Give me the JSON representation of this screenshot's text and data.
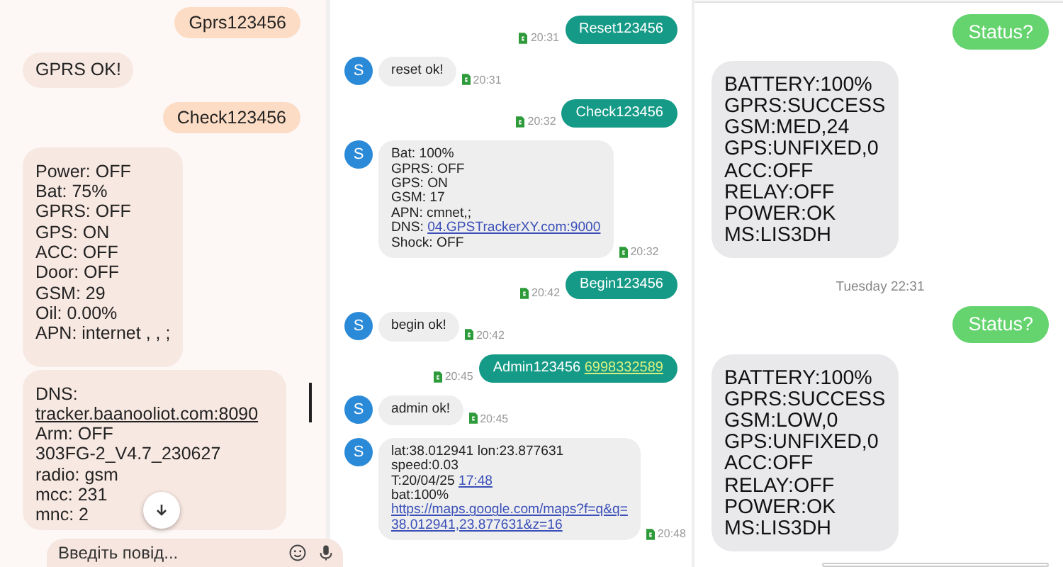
{
  "left_chat": {
    "messages": [
      {
        "kind": "out",
        "lines": [
          {
            "text": "Gprs123456"
          }
        ]
      },
      {
        "kind": "in",
        "lines": [
          {
            "text": "GPRS OK!"
          }
        ]
      },
      {
        "kind": "out",
        "lines": [
          {
            "text": "Check123456"
          }
        ]
      },
      {
        "kind": "in",
        "lines": [
          {
            "text": "Power: OFF"
          },
          {
            "text": "Bat: 75%"
          },
          {
            "text": "GPRS: OFF"
          },
          {
            "text": "GPS: ON"
          },
          {
            "text": "ACC: OFF"
          },
          {
            "text": "Door: OFF"
          },
          {
            "text": "GSM: 29"
          },
          {
            "text": "Oil: 0.00%"
          },
          {
            "text": "APN: internet , , ;"
          }
        ]
      },
      {
        "kind": "in",
        "lines": [
          {
            "text": "DNS:"
          },
          {
            "link": "tracker.baanooliot.com:8090"
          },
          {
            "text": "Arm: OFF"
          },
          {
            "text": "303FG-2_V4.7_230627"
          },
          {
            "text": "radio: gsm"
          },
          {
            "text": "mcc: 231"
          },
          {
            "text": "mnc: 2"
          }
        ]
      }
    ],
    "composer": {
      "placeholder": "Введіть повід..."
    }
  },
  "middle_chat": {
    "messages": [
      {
        "kind": "out",
        "time": "20:31",
        "lines": [
          {
            "text": "Reset123456"
          }
        ]
      },
      {
        "kind": "in",
        "avatar": "S",
        "time": "20:31",
        "lines": [
          {
            "text": "reset ok!"
          }
        ]
      },
      {
        "kind": "out",
        "time": "20:32",
        "lines": [
          {
            "text": "Check123456"
          }
        ]
      },
      {
        "kind": "in",
        "avatar": "S",
        "time": "20:32",
        "lines": [
          {
            "text": "Bat: 100%"
          },
          {
            "text": "GPRS: OFF"
          },
          {
            "text": "GPS: ON"
          },
          {
            "text": "GSM: 17"
          },
          {
            "text": "APN: cmnet,;"
          },
          {
            "text": "DNS: ",
            "link": "04.GPSTrackerXY.com:9000"
          },
          {
            "text": "Shock: OFF"
          }
        ]
      },
      {
        "kind": "out",
        "time": "20:42",
        "lines": [
          {
            "text": "Begin123456"
          }
        ]
      },
      {
        "kind": "in",
        "avatar": "S",
        "time": "20:42",
        "lines": [
          {
            "text": "begin ok!"
          }
        ]
      },
      {
        "kind": "out",
        "time": "20:45",
        "lines": [
          {
            "text": "Admin123456 ",
            "link": "6998332589"
          }
        ]
      },
      {
        "kind": "in",
        "avatar": "S",
        "time": "20:45",
        "lines": [
          {
            "text": "admin ok!"
          }
        ]
      },
      {
        "kind": "in",
        "avatar": "S",
        "time": "20:48",
        "lines": [
          {
            "text": "lat:38.012941 lon:23.877631"
          },
          {
            "text": "speed:0.03"
          },
          {
            "text": "T:20/04/25 ",
            "link": "17:48"
          },
          {
            "text": "bat:100%"
          },
          {
            "link": "https://maps.google.com/maps?f=q&q="
          },
          {
            "link": "38.012941,23.877631&z=16"
          }
        ]
      }
    ]
  },
  "right_chat": {
    "messages": [
      {
        "kind": "out",
        "lines": [
          {
            "text": "Status?"
          }
        ]
      },
      {
        "kind": "in",
        "lines": [
          {
            "text": "BATTERY:100%"
          },
          {
            "text": "GPRS:SUCCESS"
          },
          {
            "text": "GSM:MED,24"
          },
          {
            "text": "GPS:UNFIXED,0"
          },
          {
            "text": "ACC:OFF"
          },
          {
            "text": "RELAY:OFF"
          },
          {
            "text": "POWER:OK"
          },
          {
            "text": "MS:LIS3DH"
          }
        ]
      },
      {
        "kind": "stamp",
        "lines": [
          {
            "text": "Tuesday 22:31"
          }
        ]
      },
      {
        "kind": "out",
        "lines": [
          {
            "text": "Status?"
          }
        ]
      },
      {
        "kind": "in",
        "lines": [
          {
            "text": "BATTERY:100%"
          },
          {
            "text": "GPRS:SUCCESS"
          },
          {
            "text": "GSM:LOW,0"
          },
          {
            "text": "GPS:UNFIXED,0"
          },
          {
            "text": "ACC:OFF"
          },
          {
            "text": "RELAY:OFF"
          },
          {
            "text": "POWER:OK"
          },
          {
            "text": "MS:LIS3DH"
          }
        ]
      }
    ]
  }
}
